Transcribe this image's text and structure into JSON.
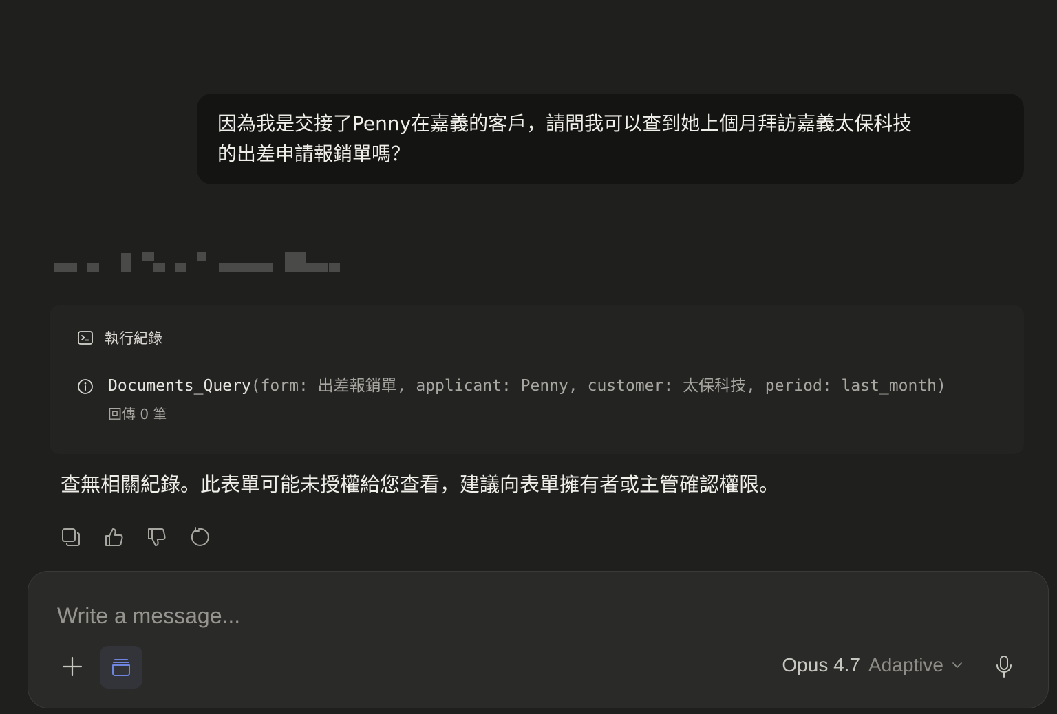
{
  "user_message": {
    "line1": "因為我是交接了Penny在嘉義的客戶，請問我可以查到她上個月拜訪嘉義太保科技",
    "line2": "的出差申請報銷單嗎？"
  },
  "execution_log": {
    "title": "執行紀錄",
    "entry": {
      "function": "Documents_Query",
      "args": "(form: 出差報銷單, applicant: Penny, customer: 太保科技, period: last_month)",
      "result": "回傳 0 筆"
    }
  },
  "assistant_message": "查無相關紀錄。此表單可能未授權給您查看，建議向表單擁有者或主管確認權限。",
  "message_actions": [
    {
      "name": "copy-icon"
    },
    {
      "name": "thumbs-up-icon"
    },
    {
      "name": "thumbs-down-icon"
    },
    {
      "name": "retry-icon"
    }
  ],
  "composer": {
    "placeholder": "Write a message...",
    "model": "Opus 4.7",
    "mode": "Adaptive"
  },
  "colors": {
    "background": "#1f1f1e",
    "user_bubble": "#141413",
    "card": "#232322",
    "composer": "#2a2a28",
    "project_icon": "#6f86e0"
  }
}
